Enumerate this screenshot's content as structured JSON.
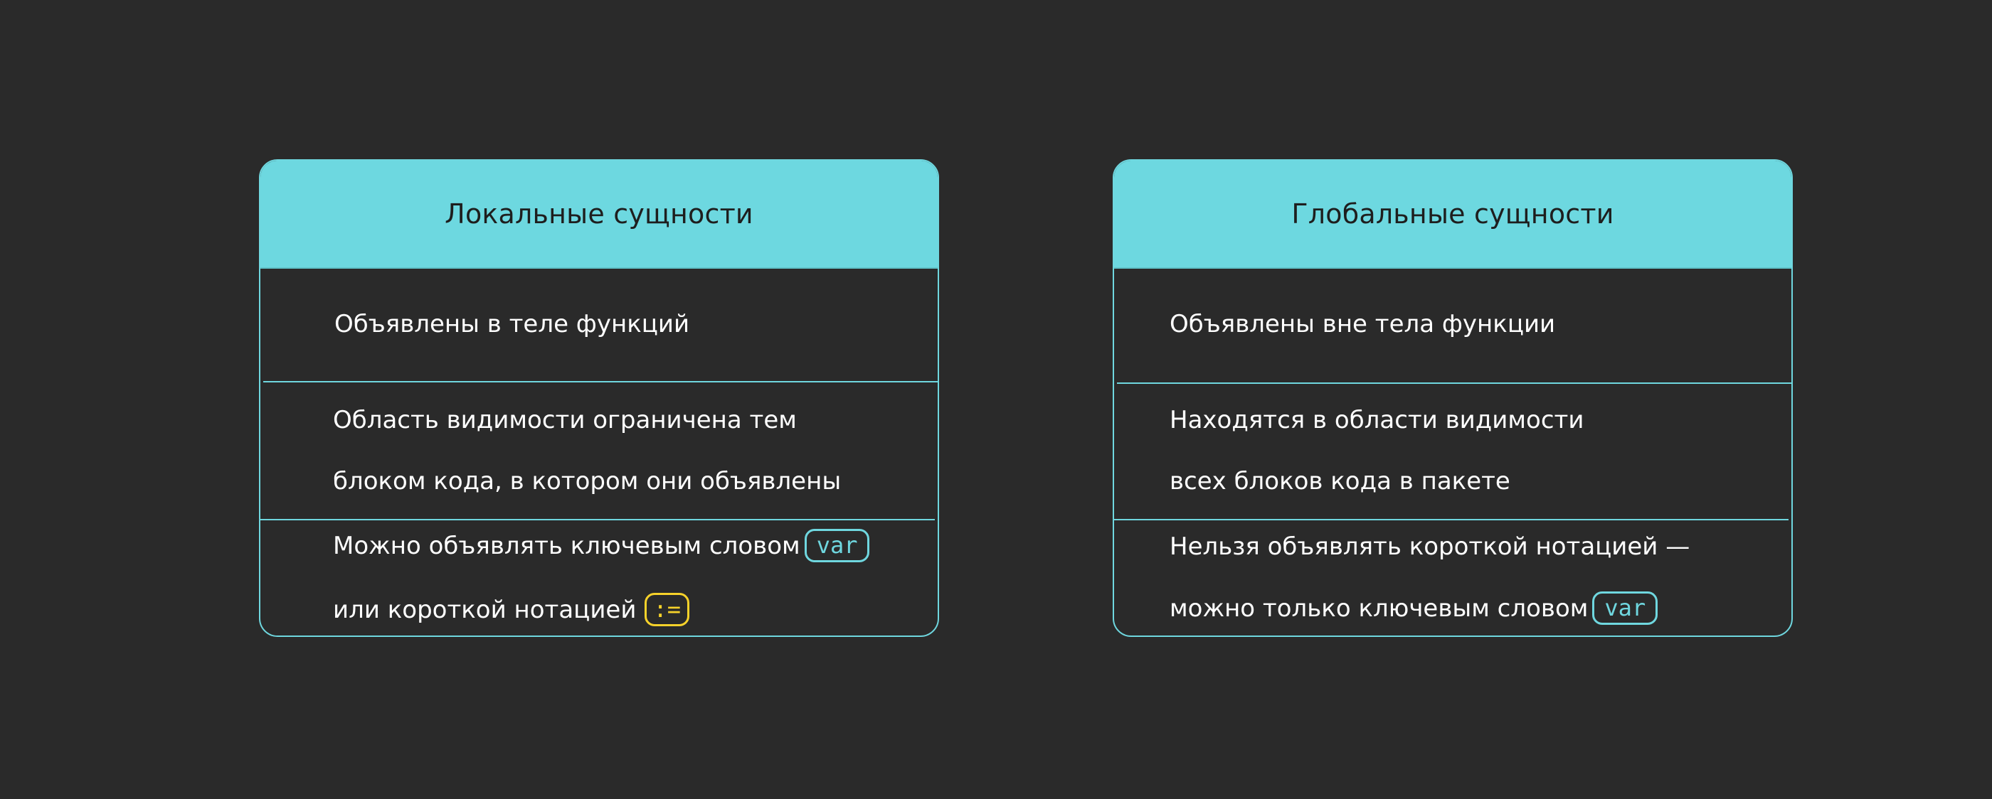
{
  "cards": [
    {
      "header": "Локальные сущности",
      "row1": "Объявлены в теле функций",
      "row2_line1": "Область видимости ограничена тем",
      "row2_line2": "блоком кода, в котором они объявлены",
      "row3_line1_text": "Можно объявлять ключевым словом",
      "row3_line1_code": "var",
      "row3_line2_text": "или короткой нотацией",
      "row3_line2_code": ":="
    },
    {
      "header": "Глобальные сущности",
      "row1": "Объявлены вне тела функции",
      "row2_line1": "Находятся в области видимости",
      "row2_line2": "всех блоков кода в пакете",
      "row3_line1_text": "Нельзя объявлять короткой нотацией —",
      "row3_line2_text": "можно только ключевым словом",
      "row3_line2_code": "var"
    }
  ],
  "colors": {
    "background": "#2a2a2a",
    "accent_cyan": "#6dd8e0",
    "accent_yellow": "#f7d22a",
    "text_light": "#ffffff",
    "text_dark": "#1e1e1e"
  }
}
